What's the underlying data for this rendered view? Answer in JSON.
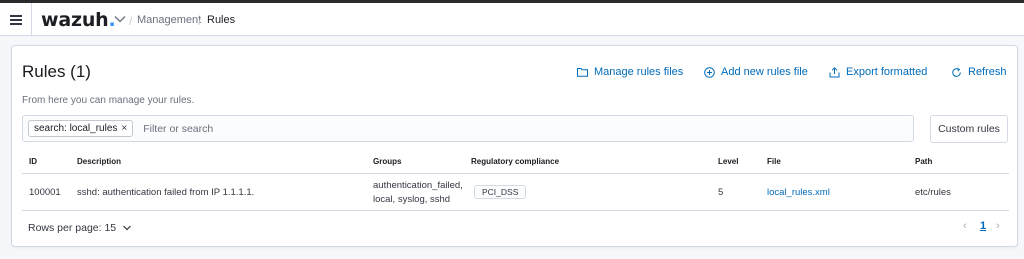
{
  "header": {
    "logo_text": "wazuh",
    "logo_dot": ".",
    "breadcrumbs": [
      {
        "label": "Management"
      },
      {
        "label": "Rules"
      }
    ]
  },
  "page": {
    "title": "Rules (1)",
    "subtitle": "From here you can manage your rules.",
    "actions": [
      {
        "label": "Manage rules files",
        "icon": "folder-icon"
      },
      {
        "label": "Add new rules file",
        "icon": "plus-circle-icon"
      },
      {
        "label": "Export formatted",
        "icon": "export-icon"
      },
      {
        "label": "Refresh",
        "icon": "refresh-icon"
      }
    ]
  },
  "search": {
    "chip_label": "search: local_rules",
    "chip_close": "×",
    "placeholder": "Filter or search"
  },
  "custom_rules_label": "Custom rules",
  "table": {
    "columns": [
      "ID",
      "Description",
      "Groups",
      "Regulatory compliance",
      "Level",
      "File",
      "Path"
    ],
    "rows": [
      {
        "id": "100001",
        "description": "sshd: authentication failed from IP 1.1.1.1.",
        "groups_line1": "authentication_failed,",
        "groups_line2": "local, syslog, sshd",
        "compliance": "PCI_DSS",
        "level": "5",
        "file": "local_rules.xml",
        "path": "etc/rules"
      }
    ]
  },
  "pagination": {
    "rows_per_page_label": "Rows per page: 15",
    "prev": "‹",
    "current_page": "1",
    "next": "›"
  },
  "colors": {
    "accent": "#006bb8",
    "logo_dot": "#3595f9",
    "border": "#d3dae6"
  }
}
